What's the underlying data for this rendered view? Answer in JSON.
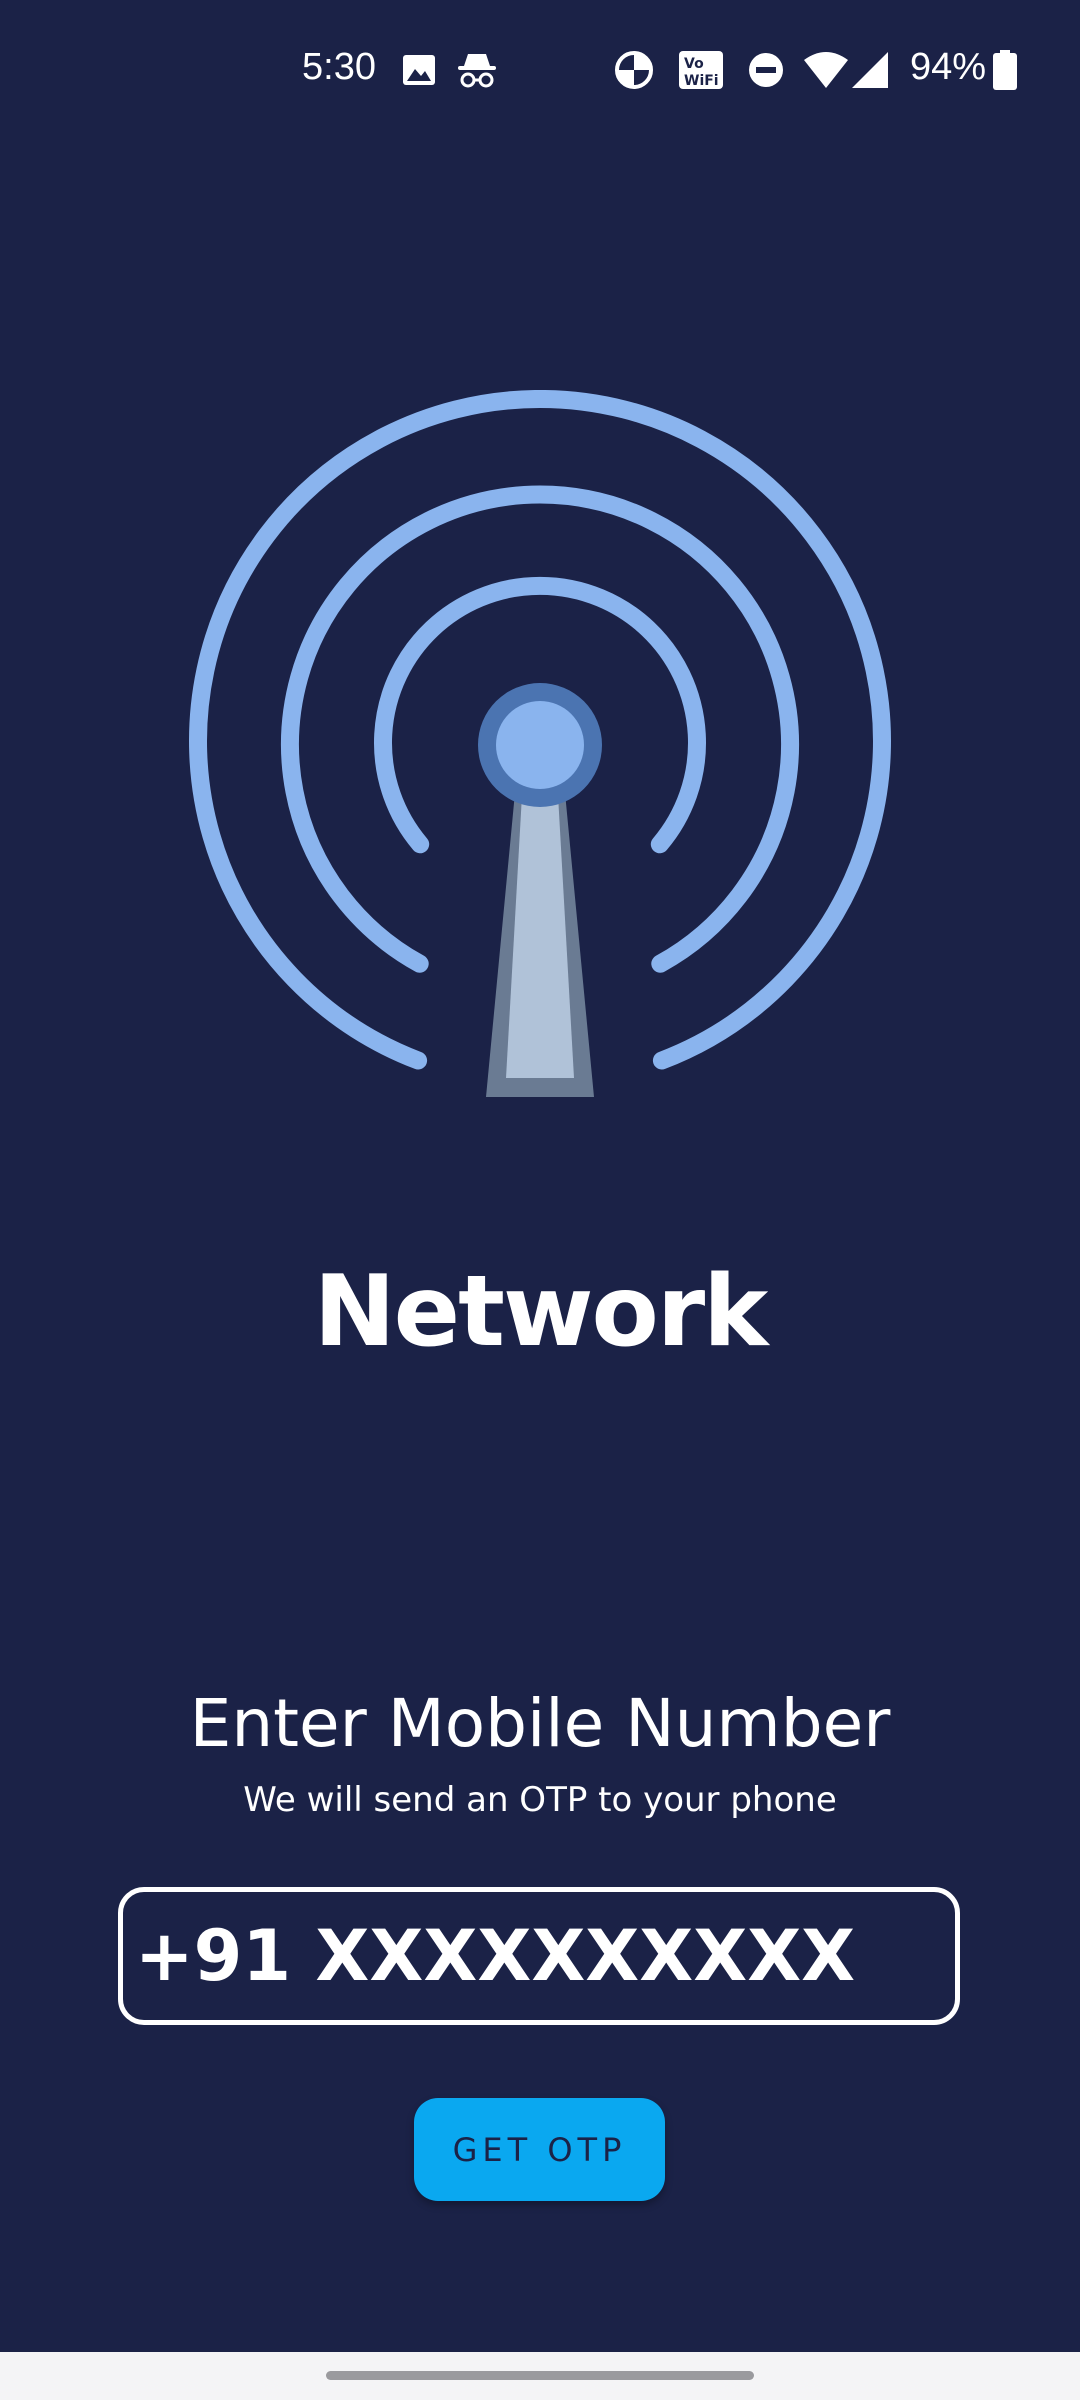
{
  "status_bar": {
    "time": "5:30",
    "battery_percent": "94%",
    "icons": [
      "gallery-icon",
      "incognito-icon",
      "data-saver-icon",
      "vowifi-icon",
      "do-not-disturb-icon",
      "wifi-icon",
      "cellular-signal-icon",
      "battery-icon"
    ]
  },
  "app": {
    "title": "Network",
    "hero_icon": "broadcast-tower-icon"
  },
  "login": {
    "heading": "Enter Mobile Number",
    "subheading": "We will send an OTP to your phone",
    "phone_placeholder": "+91 XXXXXXXXXX",
    "phone_value": "",
    "button_label": "GET OTP"
  },
  "colors": {
    "background": "#1b2247",
    "accent": "#0aa8f0",
    "signal_blue": "#8ab4ee"
  }
}
